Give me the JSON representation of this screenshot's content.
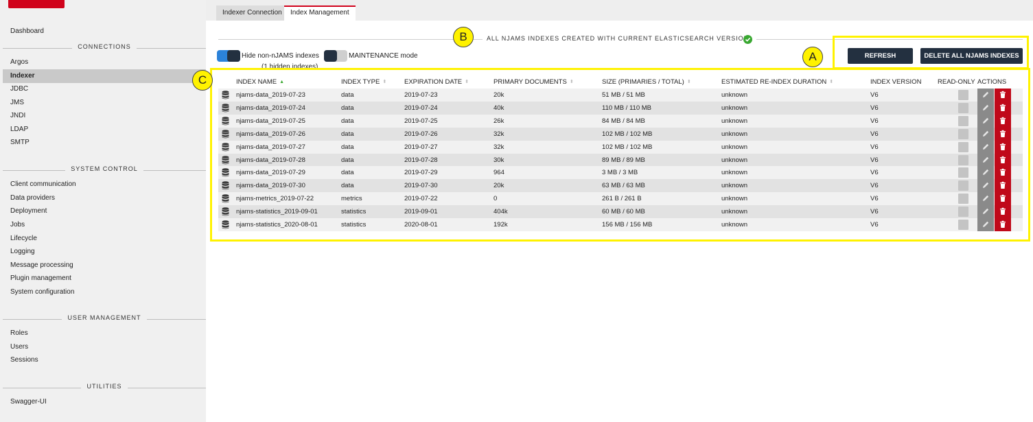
{
  "sidebar": {
    "top_item": "Dashboard",
    "sections": [
      {
        "title": "CONNECTIONS",
        "items": [
          "Argos",
          "Indexer",
          "JDBC",
          "JMS",
          "JNDI",
          "LDAP",
          "SMTP"
        ]
      },
      {
        "title": "SYSTEM CONTROL",
        "items": [
          "Client communication",
          "Data providers",
          "Deployment",
          "Jobs",
          "Lifecycle",
          "Logging",
          "Message processing",
          "Plugin management",
          "System configuration"
        ]
      },
      {
        "title": "USER MANAGEMENT",
        "items": [
          "Roles",
          "Users",
          "Sessions"
        ]
      },
      {
        "title": "UTILITIES",
        "items": [
          "Swagger-UI"
        ]
      }
    ],
    "active_item": "Indexer"
  },
  "tabs": [
    {
      "label": "Indexer Connection",
      "active": false
    },
    {
      "label": "Index Management",
      "active": true
    }
  ],
  "status": {
    "text": "ALL NJAMS INDEXES CREATED WITH CURRENT ELASTICSEARCH VERSION.",
    "icon": "check-circle-icon",
    "color": "#3aa832"
  },
  "toggles": {
    "hide_non_njams": {
      "label": "Hide non-nJAMS indexes",
      "sub_label": "(1 hidden indexes)",
      "on": true
    },
    "maintenance": {
      "label": "MAINTENANCE mode",
      "on": false
    }
  },
  "buttons": {
    "refresh": "REFRESH",
    "delete_all": "DELETE ALL NJAMS INDEXES"
  },
  "callouts": {
    "a": "A",
    "b": "B",
    "c": "C"
  },
  "table": {
    "columns": {
      "index_name": "INDEX NAME",
      "index_type": "INDEX TYPE",
      "expiration_date": "EXPIRATION DATE",
      "primary_documents": "PRIMARY DOCUMENTS",
      "size": "SIZE (PRIMARIES / TOTAL)",
      "reindex_duration": "ESTIMATED RE-INDEX DURATION",
      "index_version": "INDEX VERSION",
      "read_only": "READ-ONLY",
      "actions": "ACTIONS"
    },
    "rows": [
      {
        "name": "njams-data_2019-07-23",
        "type": "data",
        "expiration": "2019-07-23",
        "docs": "20k",
        "size": "51 MB / 51 MB",
        "reindex": "unknown",
        "version": "V6"
      },
      {
        "name": "njams-data_2019-07-24",
        "type": "data",
        "expiration": "2019-07-24",
        "docs": "40k",
        "size": "110 MB / 110 MB",
        "reindex": "unknown",
        "version": "V6"
      },
      {
        "name": "njams-data_2019-07-25",
        "type": "data",
        "expiration": "2019-07-25",
        "docs": "26k",
        "size": "84 MB / 84 MB",
        "reindex": "unknown",
        "version": "V6"
      },
      {
        "name": "njams-data_2019-07-26",
        "type": "data",
        "expiration": "2019-07-26",
        "docs": "32k",
        "size": "102 MB / 102 MB",
        "reindex": "unknown",
        "version": "V6"
      },
      {
        "name": "njams-data_2019-07-27",
        "type": "data",
        "expiration": "2019-07-27",
        "docs": "32k",
        "size": "102 MB / 102 MB",
        "reindex": "unknown",
        "version": "V6"
      },
      {
        "name": "njams-data_2019-07-28",
        "type": "data",
        "expiration": "2019-07-28",
        "docs": "30k",
        "size": "89 MB / 89 MB",
        "reindex": "unknown",
        "version": "V6"
      },
      {
        "name": "njams-data_2019-07-29",
        "type": "data",
        "expiration": "2019-07-29",
        "docs": "964",
        "size": "3 MB / 3 MB",
        "reindex": "unknown",
        "version": "V6"
      },
      {
        "name": "njams-data_2019-07-30",
        "type": "data",
        "expiration": "2019-07-30",
        "docs": "20k",
        "size": "63 MB / 63 MB",
        "reindex": "unknown",
        "version": "V6"
      },
      {
        "name": "njams-metrics_2019-07-22",
        "type": "metrics",
        "expiration": "2019-07-22",
        "docs": "0",
        "size": "261 B / 261 B",
        "reindex": "unknown",
        "version": "V6"
      },
      {
        "name": "njams-statistics_2019-09-01",
        "type": "statistics",
        "expiration": "2019-09-01",
        "docs": "404k",
        "size": "60 MB / 60 MB",
        "reindex": "unknown",
        "version": "V6"
      },
      {
        "name": "njams-statistics_2020-08-01",
        "type": "statistics",
        "expiration": "2020-08-01",
        "docs": "192k",
        "size": "156 MB / 156 MB",
        "reindex": "unknown",
        "version": "V6"
      }
    ]
  },
  "colors": {
    "accent_red": "#d0021b",
    "navy": "#233040",
    "toggle_blue": "#2b82d9",
    "highlight_yellow": "#fff200",
    "delete_red": "#c0091a"
  }
}
